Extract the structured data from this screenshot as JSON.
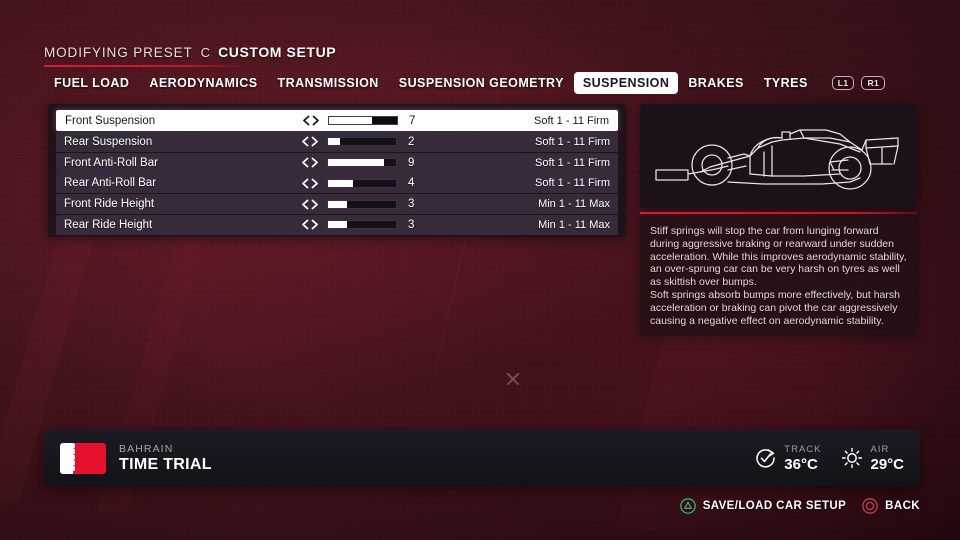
{
  "header": {
    "prefix": "MODIFYING PRESET",
    "separator": "C",
    "title": "CUSTOM SETUP"
  },
  "tabs": {
    "items": [
      {
        "label": "FUEL LOAD",
        "active": false
      },
      {
        "label": "AERODYNAMICS",
        "active": false
      },
      {
        "label": "TRANSMISSION",
        "active": false
      },
      {
        "label": "SUSPENSION GEOMETRY",
        "active": false
      },
      {
        "label": "SUSPENSION",
        "active": true
      },
      {
        "label": "BRAKES",
        "active": false
      },
      {
        "label": "TYRES",
        "active": false
      }
    ],
    "shoulder_left": "L1",
    "shoulder_right": "R1"
  },
  "settings": {
    "rows": [
      {
        "label": "Front Suspension",
        "value": "7",
        "fill": 7,
        "max": 11,
        "range": "Soft 1 - 11 Firm",
        "selected": true
      },
      {
        "label": "Rear Suspension",
        "value": "2",
        "fill": 2,
        "max": 11,
        "range": "Soft 1 - 11 Firm",
        "selected": false
      },
      {
        "label": "Front Anti-Roll Bar",
        "value": "9",
        "fill": 9,
        "max": 11,
        "range": "Soft 1 - 11 Firm",
        "selected": false
      },
      {
        "label": "Rear Anti-Roll Bar",
        "value": "4",
        "fill": 4,
        "max": 11,
        "range": "Soft 1 - 11 Firm",
        "selected": false
      },
      {
        "label": "Front Ride Height",
        "value": "3",
        "fill": 3,
        "max": 11,
        "range": "Min 1 - 11 Max",
        "selected": false
      },
      {
        "label": "Rear Ride Height",
        "value": "3",
        "fill": 3,
        "max": 11,
        "range": "Min 1 - 11 Max",
        "selected": false
      }
    ],
    "arrow_left_icon": "chevron-left-icon",
    "arrow_right_icon": "chevron-right-icon"
  },
  "info": {
    "car_icon": "f1-car-outline-icon",
    "paragraph1": "Stiff springs will stop the car from lunging forward during aggressive braking or rearward under sudden acceleration. While this improves aerodynamic stability, an over-sprung car can be very harsh on tyres as well as skittish over bumps.",
    "paragraph2": "Soft springs absorb bumps more effectively, but harsh acceleration or braking can pivot the car aggressively causing a negative effect on aerodynamic stability."
  },
  "bottom_bar": {
    "flag_icon": "bahrain-flag-icon",
    "country": "BAHRAIN",
    "session": "TIME TRIAL",
    "weather": [
      {
        "icon": "track-temp-icon",
        "label": "TRACK",
        "value": "36°C"
      },
      {
        "icon": "sun-icon",
        "label": "AIR",
        "value": "29°C"
      }
    ]
  },
  "footer": {
    "buttons": [
      {
        "icon": "ps-triangle-icon",
        "label": "SAVE/LOAD CAR SETUP"
      },
      {
        "icon": "ps-circle-icon",
        "label": "BACK"
      }
    ]
  },
  "colors": {
    "background": "#4a1720",
    "accent_red": "#e01b2e",
    "panel_dark": "#1b1119",
    "row_fill": "#3a2e3e",
    "selected_bg": "#ffffff",
    "bottom_bar": "#1c1a22",
    "flag_red": "#e8112d",
    "ps_triangle_green": "#3fa877",
    "ps_circle_red": "#c4434f"
  }
}
